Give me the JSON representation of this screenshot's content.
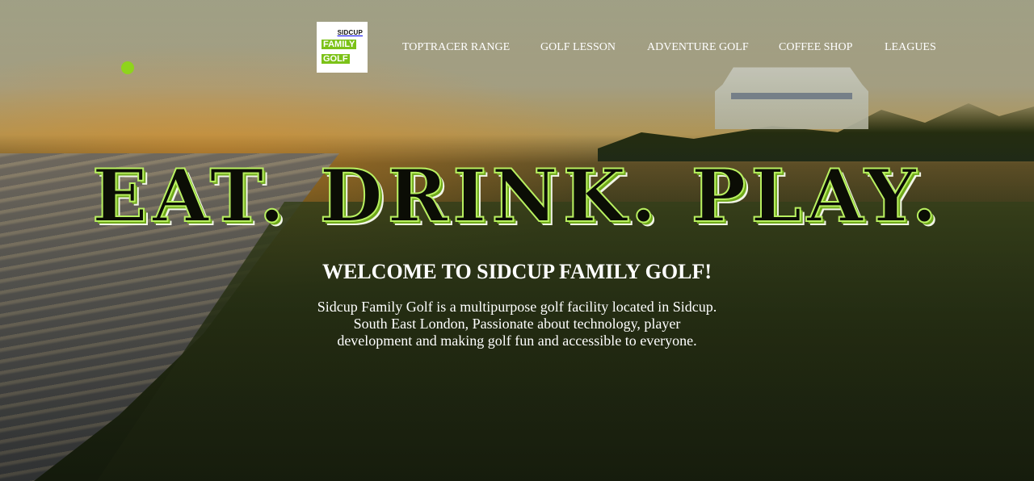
{
  "logo": {
    "line1": "SIDCUP",
    "line2": "FAMILY",
    "line3": "GOLF"
  },
  "nav": {
    "items": [
      {
        "label": "TOPTRACER RANGE"
      },
      {
        "label": "GOLF LESSON"
      },
      {
        "label": "ADVENTURE GOLF"
      },
      {
        "label": "COFFEE SHOP"
      },
      {
        "label": "LEAGUES"
      }
    ]
  },
  "hero": {
    "headline": "EAT. DRINK. PLAY.",
    "welcome": "WELCOME TO SIDCUP FAMILY GOLF!",
    "description_lines": [
      "Sidcup Family Golf is a multipurpose golf facility located in Sidcup.",
      "South East London, Passionate about technology, player",
      "development and making golf fun and accessible to everyone."
    ]
  },
  "colors": {
    "accent": "#7cc218",
    "text": "#ffffff",
    "headline_fill": "#0b0d05"
  }
}
